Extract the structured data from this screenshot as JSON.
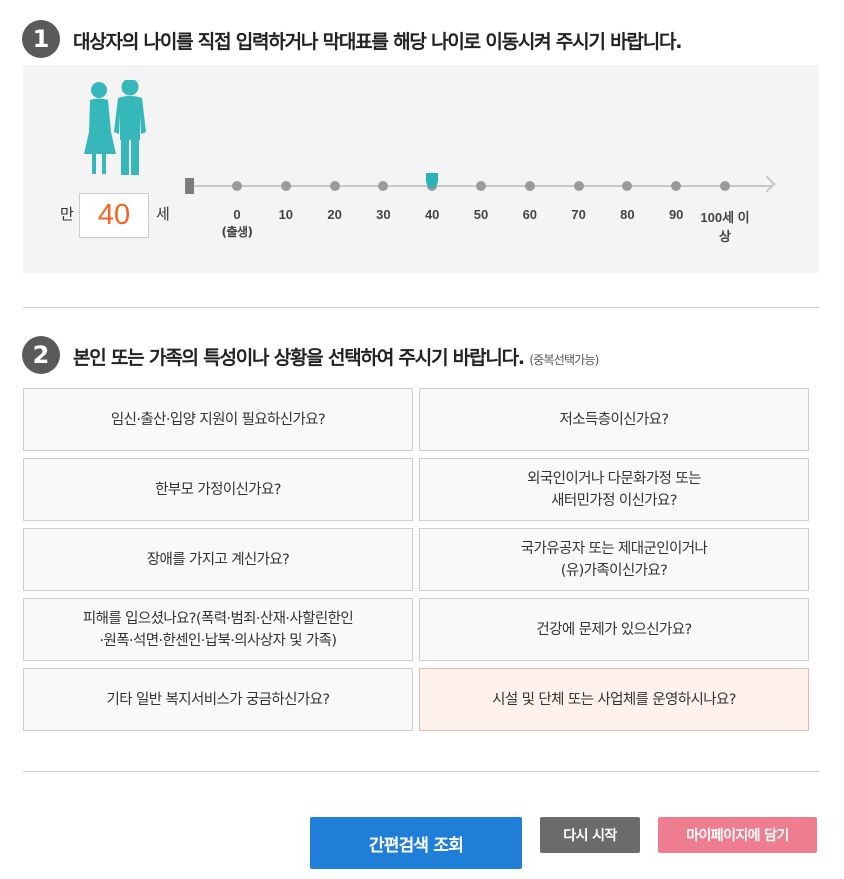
{
  "step1": {
    "number": "1",
    "title": "대상자의 나이를 직접 입력하거나 막대표를 해당 나이로 이동시켜 주시기 바랍니다."
  },
  "age": {
    "prefix": "만",
    "value": "40",
    "suffix": "세",
    "selected_age": 40,
    "ticks": [
      "0",
      "10",
      "20",
      "30",
      "40",
      "50",
      "60",
      "70",
      "80",
      "90",
      "100세 이상"
    ],
    "tick0_sub": "(출생)",
    "handle_color": "#2bb3b8",
    "figure_color": "#36b7b9"
  },
  "step2": {
    "number": "2",
    "title": "본인 또는 가족의 특성이나 상황을 선택하여 주시기 바랍니다.",
    "note": "(중복선택가능)"
  },
  "options": [
    {
      "label": "임신·출산·입양 지원이 필요하신가요?",
      "selected": false
    },
    {
      "label": "저소득층이신가요?",
      "selected": false
    },
    {
      "label": "한부모 가정이신가요?",
      "selected": false
    },
    {
      "label": "외국인이거나 다문화가정 또는\n새터민가정 이신가요?",
      "selected": false
    },
    {
      "label": "장애를 가지고 계신가요?",
      "selected": false
    },
    {
      "label": "국가유공자 또는 제대군인이거나\n(유)가족이신가요?",
      "selected": false
    },
    {
      "label": "피해를 입으셨나요?(폭력·범죄·산재·사할린한인\n·원폭·석면·한센인·납북·의사상자 및 가족)",
      "selected": false
    },
    {
      "label": "건강에 문제가 있으신가요?",
      "selected": false
    },
    {
      "label": "기타 일반 복지서비스가 궁금하신가요?",
      "selected": false
    },
    {
      "label": "시설 및 단체 또는 사업체를 운영하시나요?",
      "selected": true
    }
  ],
  "buttons": {
    "search": "간편검색 조회",
    "restart": "다시 시작",
    "mypage": "마이페이지에 담기"
  },
  "colors": {
    "search_button": "#1f7fd8",
    "restart_button": "#6b6b6b",
    "mypage_button": "#ee7d8f",
    "age_value": "#f26522",
    "selected_option_bg": "#fff1ec"
  }
}
